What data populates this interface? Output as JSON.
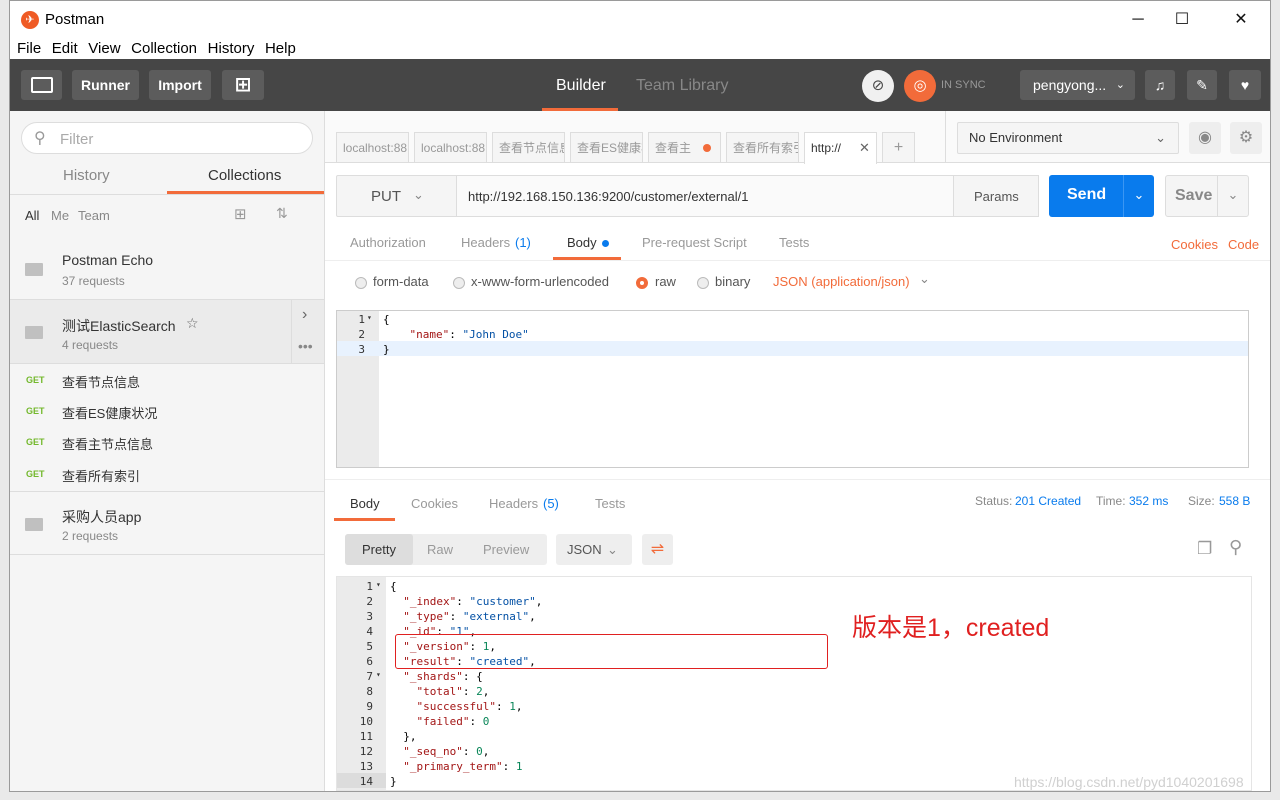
{
  "window": {
    "title": "Postman"
  },
  "menu": [
    "File",
    "Edit",
    "View",
    "Collection",
    "History",
    "Help"
  ],
  "toolbar": {
    "runner": "Runner",
    "import": "Import",
    "builder": "Builder",
    "team_library": "Team Library",
    "sync": "IN SYNC",
    "user": "pengyong..."
  },
  "sidebar": {
    "filter_placeholder": "Filter",
    "tabs": [
      "History",
      "Collections"
    ],
    "subfilters": [
      "All",
      "Me",
      "Team"
    ],
    "collections": [
      {
        "name": "Postman Echo",
        "count": "37 requests"
      },
      {
        "name": "测试ElasticSearch",
        "count": "4 requests"
      },
      {
        "name": "采购人员app",
        "count": "2 requests"
      }
    ],
    "requests": [
      {
        "method": "GET",
        "name": "查看节点信息"
      },
      {
        "method": "GET",
        "name": "查看ES健康状况"
      },
      {
        "method": "GET",
        "name": "查看主节点信息"
      },
      {
        "method": "GET",
        "name": "查看所有索引"
      }
    ]
  },
  "tabs": [
    "localhost:88",
    "localhost:88",
    "查看节点信息",
    "查看ES健康状",
    "查看主",
    "查看所有索引",
    "http://"
  ],
  "environment": "No Environment",
  "request": {
    "method": "PUT",
    "url": "http://192.168.150.136:9200/customer/external/1",
    "params": "Params",
    "send": "Send",
    "save": "Save",
    "tabs": [
      "Authorization",
      "Headers",
      "(1)",
      "Body",
      "Pre-request Script",
      "Tests"
    ],
    "cookies": "Cookies",
    "code": "Code",
    "body_modes": [
      "form-data",
      "x-www-form-urlencoded",
      "raw",
      "binary"
    ],
    "content_type": "JSON (application/json)",
    "body_lines": [
      "{",
      "    \"name\": \"John Doe\"",
      "}"
    ]
  },
  "response": {
    "tabs": [
      "Body",
      "Cookies",
      "Headers",
      "(5)",
      "Tests"
    ],
    "status_label": "Status:",
    "status_value": "201 Created",
    "time_label": "Time:",
    "time_value": "352 ms",
    "size_label": "Size:",
    "size_value": "558 B",
    "formats": [
      "Pretty",
      "Raw",
      "Preview"
    ],
    "format_select": "JSON",
    "lines": [
      "{",
      "  \"_index\": \"customer\",",
      "  \"_type\": \"external\",",
      "  \"_id\": \"1\",",
      "  \"_version\": 1,",
      "  \"result\": \"created\",",
      "  \"_shards\": {",
      "    \"total\": 2,",
      "    \"successful\": 1,",
      "    \"failed\": 0",
      "  },",
      "  \"_seq_no\": 0,",
      "  \"_primary_term\": 1",
      "}"
    ]
  },
  "annotation": "版本是1，created",
  "watermark": "https://blog.csdn.net/pyd1040201698",
  "colors": {
    "accent": "#f26b3a",
    "send": "#097bed",
    "toolbar": "#464646",
    "get": "#73b82c"
  }
}
